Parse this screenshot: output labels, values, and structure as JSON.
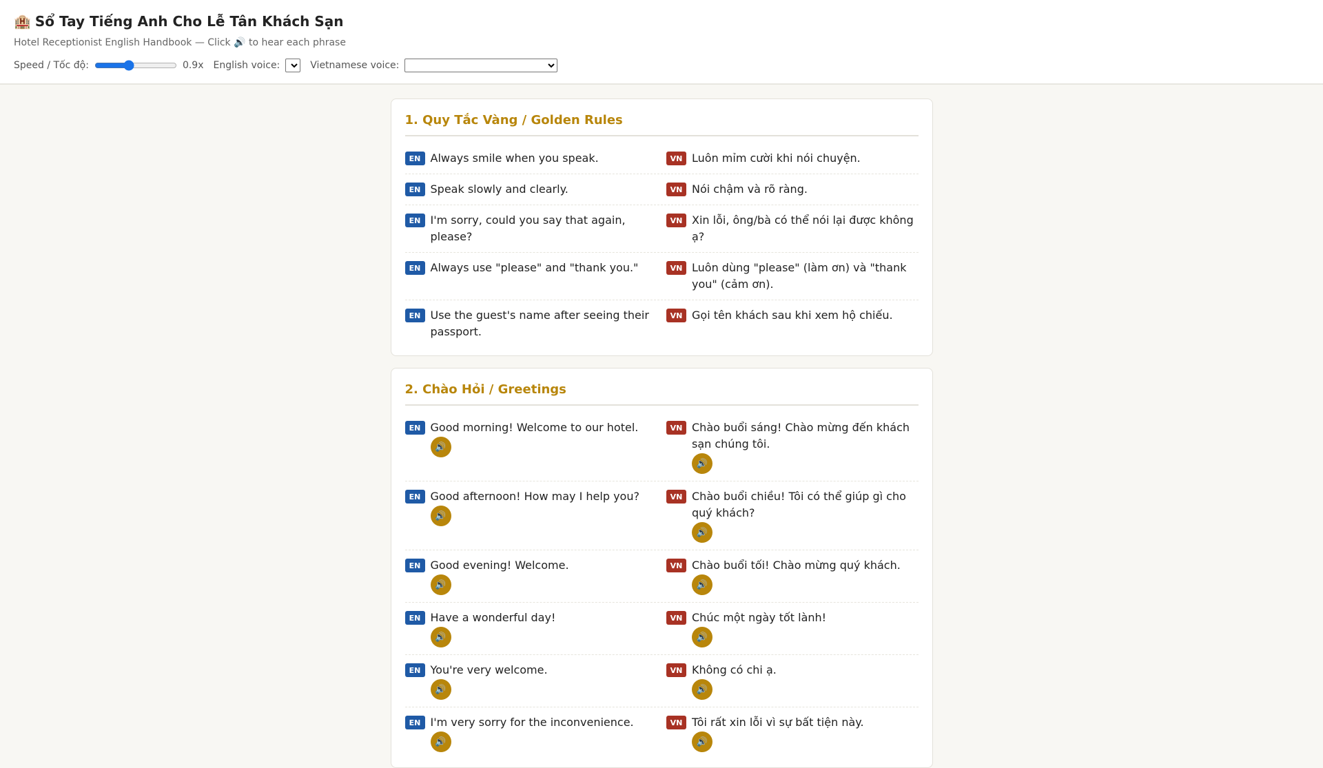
{
  "header": {
    "icon": "🏨",
    "title": "Sổ Tay Tiếng Anh Cho Lễ Tân Khách Sạn",
    "subtitle": "Hotel Receptionist English Handbook — Click 🔊 to hear each phrase",
    "speed_label": "Speed / Tốc độ:",
    "speed_value": "0.9x",
    "speed": 0.9,
    "english_voice_label": "English voice:",
    "vietnamese_voice_label": "Vietnamese voice:"
  },
  "badges": {
    "en": "EN",
    "vn": "VN"
  },
  "speaker_icon": "🔊",
  "sections": [
    {
      "title": "1. Quy Tắc Vàng / Golden Rules",
      "rows": [
        {
          "en": "Always smile when you speak.",
          "vn": "Luôn mỉm cười khi nói chuyện."
        },
        {
          "en": "Speak slowly and clearly.",
          "vn": "Nói chậm và rõ ràng."
        },
        {
          "en": "I'm sorry, could you say that again, please?",
          "vn": "Xin lỗi, ông/bà có thể nói lại được không ạ?"
        },
        {
          "en": "Always use \"please\" and \"thank you.\"",
          "vn": "Luôn dùng \"please\" (làm ơn) và \"thank you\" (cảm ơn)."
        },
        {
          "en": "Use the guest's name after seeing their passport.",
          "vn": "Gọi tên khách sau khi xem hộ chiếu."
        }
      ]
    },
    {
      "title": "2. Chào Hỏi / Greetings",
      "rows": [
        {
          "en": "Good morning! Welcome to our hotel.",
          "vn": "Chào buổi sáng! Chào mừng đến khách sạn chúng tôi."
        },
        {
          "en": "Good afternoon! How may I help you?",
          "vn": "Chào buổi chiều! Tôi có thể giúp gì cho quý khách?"
        },
        {
          "en": "Good evening! Welcome.",
          "vn": "Chào buổi tối! Chào mừng quý khách."
        },
        {
          "en": "Have a wonderful day!",
          "vn": "Chúc một ngày tốt lành!"
        },
        {
          "en": "You're very welcome.",
          "vn": "Không có chi ạ."
        },
        {
          "en": "I'm very sorry for the inconvenience.",
          "vn": "Tôi rất xin lỗi vì sự bất tiện này."
        }
      ]
    }
  ]
}
